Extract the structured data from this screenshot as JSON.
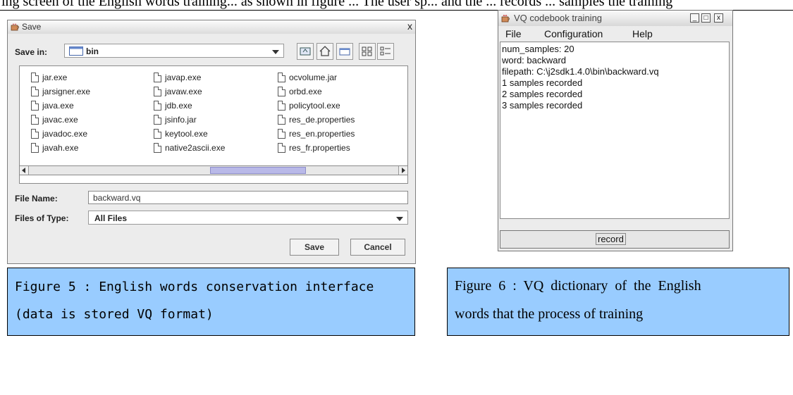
{
  "top_text": "ing screen of the English words training... as shown in figure ... The user sp... and the ... records ... samples the training",
  "save_dialog": {
    "title": "Save",
    "close_glyph": "x",
    "save_in_label": "Save in:",
    "save_in_value": "bin",
    "files": [
      [
        "jar.exe",
        "javap.exe",
        "ocvolume.jar"
      ],
      [
        "jarsigner.exe",
        "javaw.exe",
        "orbd.exe"
      ],
      [
        "java.exe",
        "jdb.exe",
        "policytool.exe"
      ],
      [
        "javac.exe",
        "jsinfo.jar",
        "res_de.properties"
      ],
      [
        "javadoc.exe",
        "keytool.exe",
        "res_en.properties"
      ],
      [
        "javah.exe",
        "native2ascii.exe",
        "res_fr.properties"
      ]
    ],
    "file_name_label": "File Name:",
    "file_name_value": "backward.vq",
    "files_of_type_label": "Files of Type:",
    "files_of_type_value": "All Files",
    "save_button": "Save",
    "cancel_button": "Cancel"
  },
  "vq_window": {
    "title": "VQ codebook training",
    "controls": [
      "_",
      "□",
      "x"
    ],
    "menu": [
      "File",
      "Configuration",
      "Help"
    ],
    "lines": [
      "num_samples: 20",
      "word: backward",
      "filepath: C:\\j2sdk1.4.0\\bin\\backward.vq",
      "1 samples recorded",
      "2 samples recorded",
      "3 samples recorded"
    ],
    "record_button": "record"
  },
  "captions": {
    "fig5_line1": "Figure 5 : English words conservation interface",
    "fig5_line2": "(data is stored VQ format)",
    "fig6_line1": "Figure  6  :  VQ  dictionary  of  the  English",
    "fig6_line2": "words that the process of training"
  },
  "colors": {
    "caption_bg": "#99ccff",
    "scroll_thumb": "#b9b9e8"
  }
}
